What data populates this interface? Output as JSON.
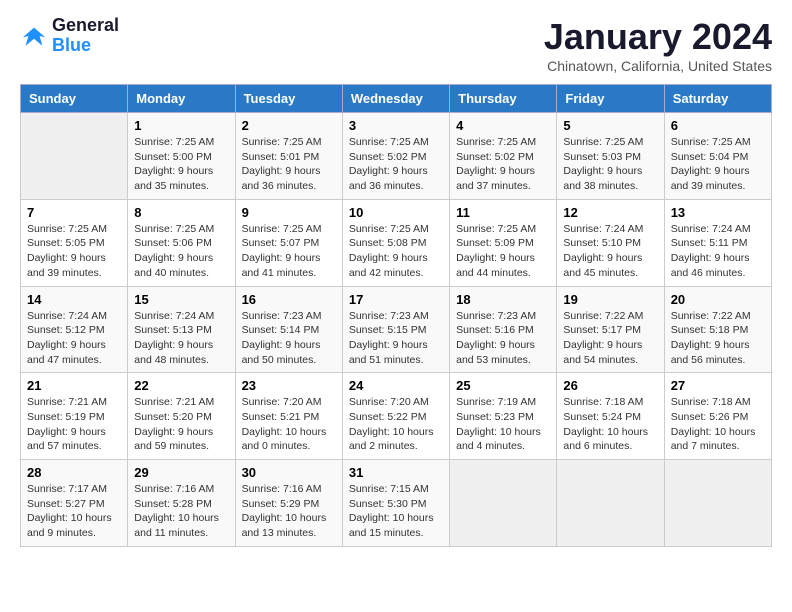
{
  "logo": {
    "text_general": "General",
    "text_blue": "Blue"
  },
  "title": "January 2024",
  "location": "Chinatown, California, United States",
  "headers": [
    "Sunday",
    "Monday",
    "Tuesday",
    "Wednesday",
    "Thursday",
    "Friday",
    "Saturday"
  ],
  "weeks": [
    [
      {
        "day": "",
        "info": ""
      },
      {
        "day": "1",
        "info": "Sunrise: 7:25 AM\nSunset: 5:00 PM\nDaylight: 9 hours\nand 35 minutes."
      },
      {
        "day": "2",
        "info": "Sunrise: 7:25 AM\nSunset: 5:01 PM\nDaylight: 9 hours\nand 36 minutes."
      },
      {
        "day": "3",
        "info": "Sunrise: 7:25 AM\nSunset: 5:02 PM\nDaylight: 9 hours\nand 36 minutes."
      },
      {
        "day": "4",
        "info": "Sunrise: 7:25 AM\nSunset: 5:02 PM\nDaylight: 9 hours\nand 37 minutes."
      },
      {
        "day": "5",
        "info": "Sunrise: 7:25 AM\nSunset: 5:03 PM\nDaylight: 9 hours\nand 38 minutes."
      },
      {
        "day": "6",
        "info": "Sunrise: 7:25 AM\nSunset: 5:04 PM\nDaylight: 9 hours\nand 39 minutes."
      }
    ],
    [
      {
        "day": "7",
        "info": "Sunrise: 7:25 AM\nSunset: 5:05 PM\nDaylight: 9 hours\nand 39 minutes."
      },
      {
        "day": "8",
        "info": "Sunrise: 7:25 AM\nSunset: 5:06 PM\nDaylight: 9 hours\nand 40 minutes."
      },
      {
        "day": "9",
        "info": "Sunrise: 7:25 AM\nSunset: 5:07 PM\nDaylight: 9 hours\nand 41 minutes."
      },
      {
        "day": "10",
        "info": "Sunrise: 7:25 AM\nSunset: 5:08 PM\nDaylight: 9 hours\nand 42 minutes."
      },
      {
        "day": "11",
        "info": "Sunrise: 7:25 AM\nSunset: 5:09 PM\nDaylight: 9 hours\nand 44 minutes."
      },
      {
        "day": "12",
        "info": "Sunrise: 7:24 AM\nSunset: 5:10 PM\nDaylight: 9 hours\nand 45 minutes."
      },
      {
        "day": "13",
        "info": "Sunrise: 7:24 AM\nSunset: 5:11 PM\nDaylight: 9 hours\nand 46 minutes."
      }
    ],
    [
      {
        "day": "14",
        "info": "Sunrise: 7:24 AM\nSunset: 5:12 PM\nDaylight: 9 hours\nand 47 minutes."
      },
      {
        "day": "15",
        "info": "Sunrise: 7:24 AM\nSunset: 5:13 PM\nDaylight: 9 hours\nand 48 minutes."
      },
      {
        "day": "16",
        "info": "Sunrise: 7:23 AM\nSunset: 5:14 PM\nDaylight: 9 hours\nand 50 minutes."
      },
      {
        "day": "17",
        "info": "Sunrise: 7:23 AM\nSunset: 5:15 PM\nDaylight: 9 hours\nand 51 minutes."
      },
      {
        "day": "18",
        "info": "Sunrise: 7:23 AM\nSunset: 5:16 PM\nDaylight: 9 hours\nand 53 minutes."
      },
      {
        "day": "19",
        "info": "Sunrise: 7:22 AM\nSunset: 5:17 PM\nDaylight: 9 hours\nand 54 minutes."
      },
      {
        "day": "20",
        "info": "Sunrise: 7:22 AM\nSunset: 5:18 PM\nDaylight: 9 hours\nand 56 minutes."
      }
    ],
    [
      {
        "day": "21",
        "info": "Sunrise: 7:21 AM\nSunset: 5:19 PM\nDaylight: 9 hours\nand 57 minutes."
      },
      {
        "day": "22",
        "info": "Sunrise: 7:21 AM\nSunset: 5:20 PM\nDaylight: 9 hours\nand 59 minutes."
      },
      {
        "day": "23",
        "info": "Sunrise: 7:20 AM\nSunset: 5:21 PM\nDaylight: 10 hours\nand 0 minutes."
      },
      {
        "day": "24",
        "info": "Sunrise: 7:20 AM\nSunset: 5:22 PM\nDaylight: 10 hours\nand 2 minutes."
      },
      {
        "day": "25",
        "info": "Sunrise: 7:19 AM\nSunset: 5:23 PM\nDaylight: 10 hours\nand 4 minutes."
      },
      {
        "day": "26",
        "info": "Sunrise: 7:18 AM\nSunset: 5:24 PM\nDaylight: 10 hours\nand 6 minutes."
      },
      {
        "day": "27",
        "info": "Sunrise: 7:18 AM\nSunset: 5:26 PM\nDaylight: 10 hours\nand 7 minutes."
      }
    ],
    [
      {
        "day": "28",
        "info": "Sunrise: 7:17 AM\nSunset: 5:27 PM\nDaylight: 10 hours\nand 9 minutes."
      },
      {
        "day": "29",
        "info": "Sunrise: 7:16 AM\nSunset: 5:28 PM\nDaylight: 10 hours\nand 11 minutes."
      },
      {
        "day": "30",
        "info": "Sunrise: 7:16 AM\nSunset: 5:29 PM\nDaylight: 10 hours\nand 13 minutes."
      },
      {
        "day": "31",
        "info": "Sunrise: 7:15 AM\nSunset: 5:30 PM\nDaylight: 10 hours\nand 15 minutes."
      },
      {
        "day": "",
        "info": ""
      },
      {
        "day": "",
        "info": ""
      },
      {
        "day": "",
        "info": ""
      }
    ]
  ]
}
